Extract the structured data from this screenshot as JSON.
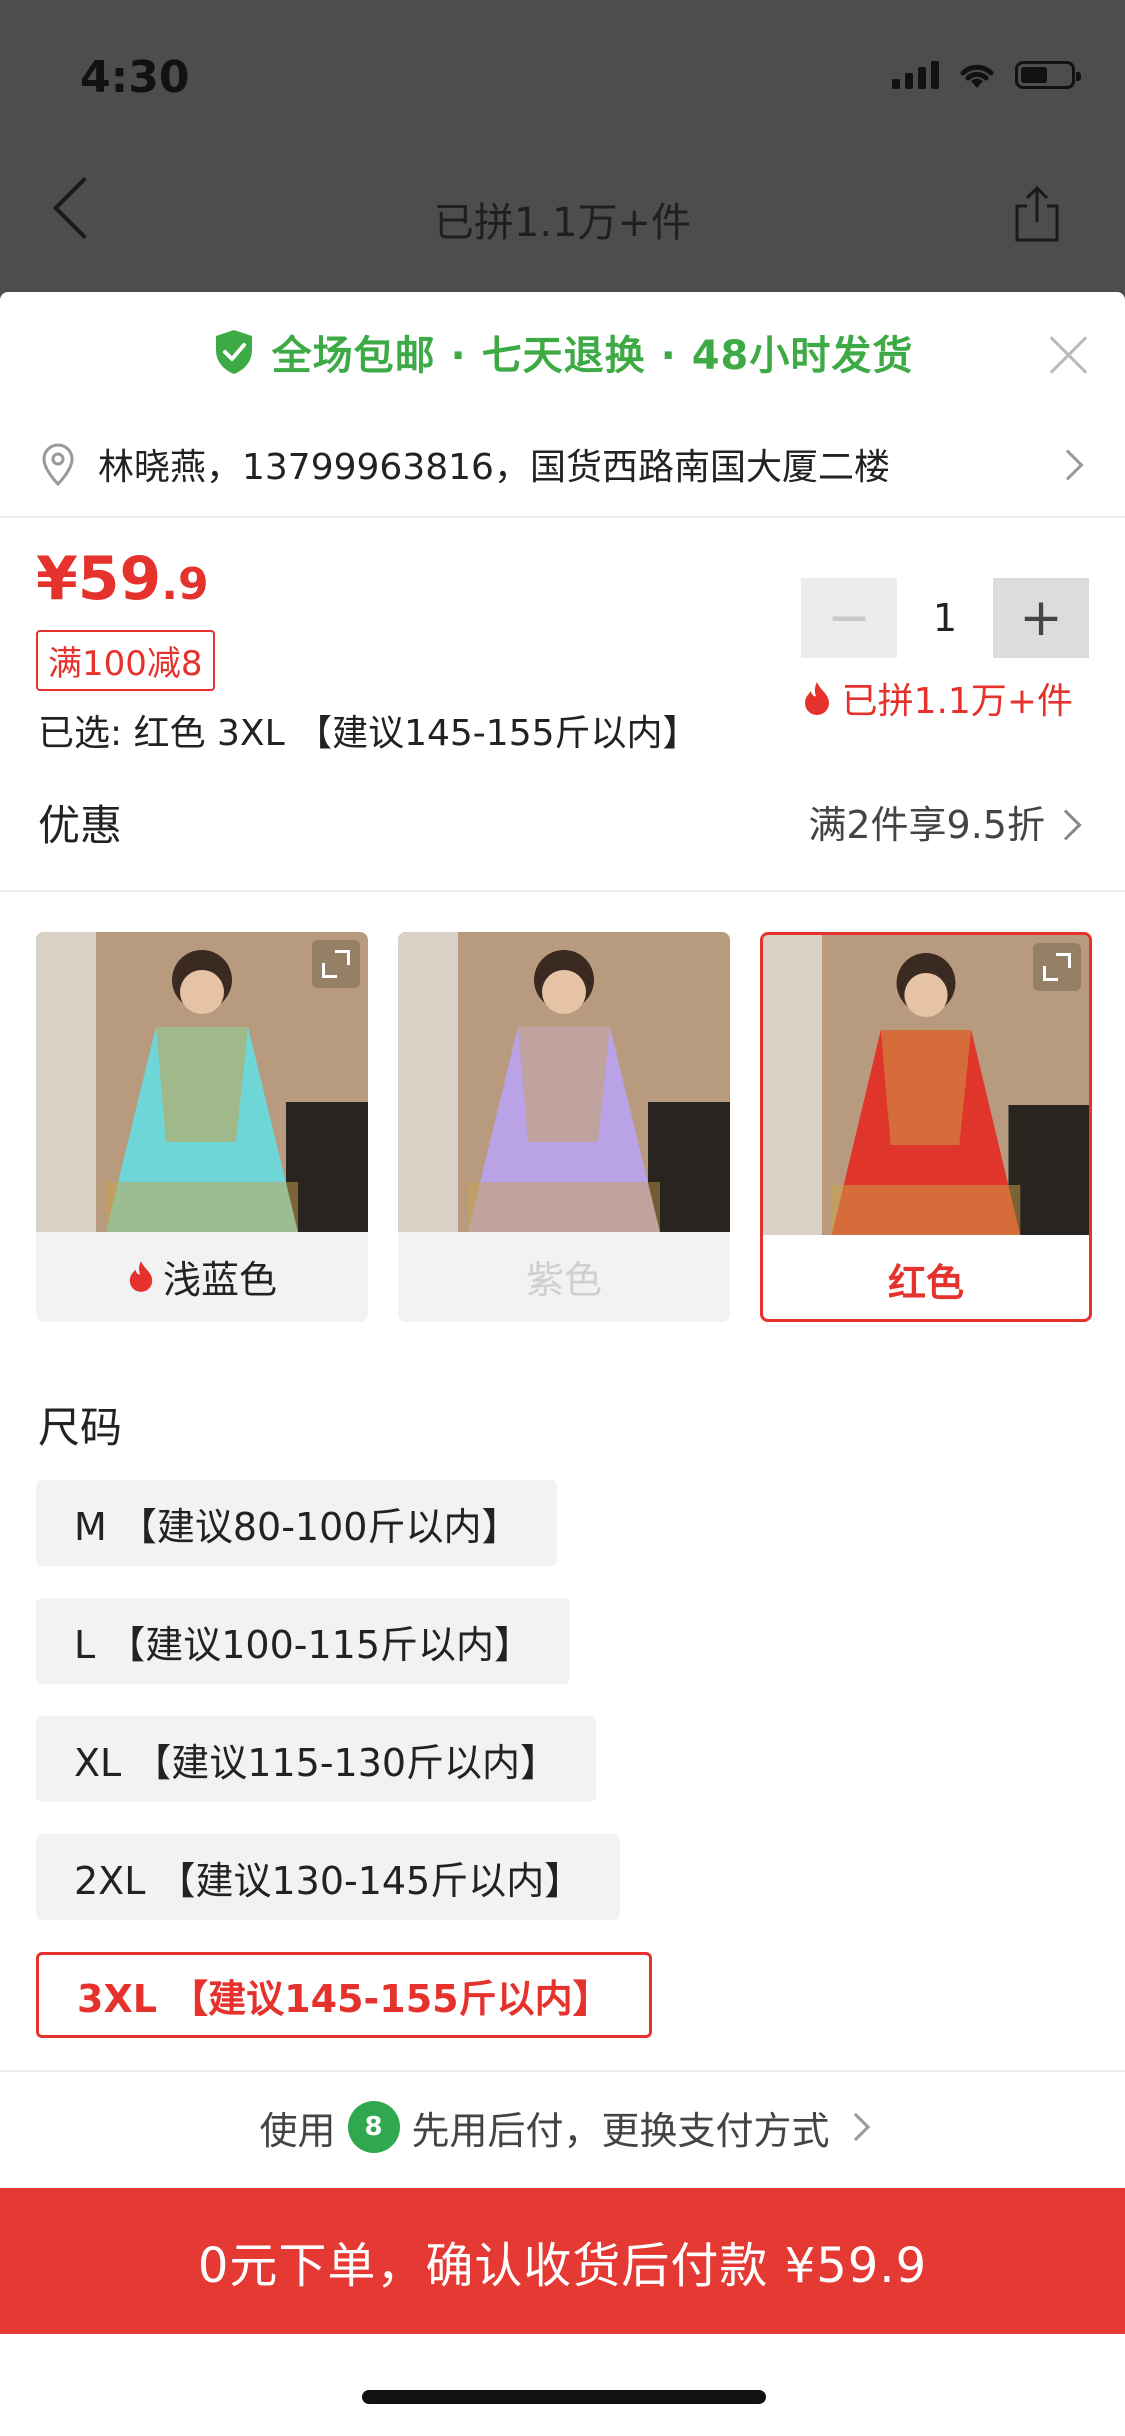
{
  "status_bar": {
    "time": "4:30"
  },
  "nav": {
    "title": "已拼1.1万+件"
  },
  "promo": {
    "text": "全场包邮 · 七天退换 · 48小时发货"
  },
  "address": {
    "text": "林晓燕，13799963816，国货西路南国大厦二楼"
  },
  "product": {
    "price_currency": "¥",
    "price_int": "59",
    "price_dec": ".9",
    "coupon": "满100减8",
    "selected_text": "已选: 红色 3XL 【建议145-155斤以内】",
    "quantity": "1",
    "minus_label": "−",
    "plus_label": "+",
    "sold_text": "已拼1.1万+件"
  },
  "discount": {
    "label": "优惠",
    "detail": "满2件享9.5折"
  },
  "colors": [
    {
      "label": "浅蓝色",
      "hot": true,
      "state": "normal",
      "dress_color": "#6fd6d8"
    },
    {
      "label": "紫色",
      "hot": false,
      "state": "disabled",
      "dress_color": "#b9a2e6"
    },
    {
      "label": "红色",
      "hot": false,
      "state": "selected",
      "dress_color": "#e0352a"
    }
  ],
  "size": {
    "title": "尺码",
    "options": [
      {
        "label": "M 【建议80-100斤以内】",
        "selected": false
      },
      {
        "label": "L 【建议100-115斤以内】",
        "selected": false
      },
      {
        "label": "XL 【建议115-130斤以内】",
        "selected": false
      },
      {
        "label": "2XL 【建议130-145斤以内】",
        "selected": false
      },
      {
        "label": "3XL 【建议145-155斤以内】",
        "selected": true
      }
    ]
  },
  "payment": {
    "prefix": "使用",
    "badge": "8",
    "text": "先用后付，更换支付方式"
  },
  "order_button": {
    "text": "0元下单，确认收货后付款 ¥59.9"
  },
  "colors_theme": {
    "accent": "#e5322d",
    "promo_green": "#3eaa46",
    "order_red": "#e53a33"
  }
}
